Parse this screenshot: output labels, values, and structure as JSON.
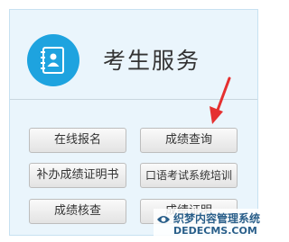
{
  "panel": {
    "title": "考生服务",
    "icon": "contact-book-icon"
  },
  "buttons": {
    "online_registration": "在线报名",
    "score_query": "成绩查询",
    "reissue_certificate": "补办成绩证明书",
    "oral_exam_training": "口语考试系统培训",
    "score_verification": "成绩核查",
    "score_certificate": "成绩证明"
  },
  "watermark": {
    "line1": "织梦内容管理系统",
    "line2": "DEDECMS.COM"
  },
  "colors": {
    "accent": "#1ea3df",
    "panel_bg": "#eaf5fc",
    "arrow": "#e53030"
  }
}
